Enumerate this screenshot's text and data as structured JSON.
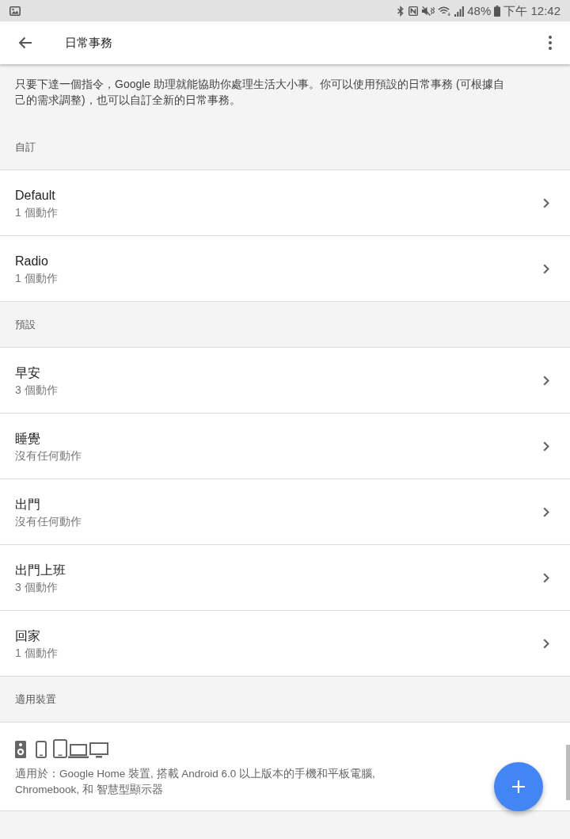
{
  "status_bar": {
    "battery": "48%",
    "time": "下午 12:42"
  },
  "app_bar": {
    "title": "日常事務"
  },
  "description": "只要下達一個指令，Google 助理就能協助你處理生活大小事。你可以使用預設的日常事務 (可根據自己的需求調整)，也可以自訂全新的日常事務。",
  "sections": [
    {
      "header": "自訂",
      "items": [
        {
          "title": "Default",
          "subtitle": "1 個動作"
        },
        {
          "title": "Radio",
          "subtitle": "1 個動作"
        }
      ]
    },
    {
      "header": "預設",
      "items": [
        {
          "title": "早安",
          "subtitle": "3 個動作"
        },
        {
          "title": "睡覺",
          "subtitle": "沒有任何動作"
        },
        {
          "title": "出門",
          "subtitle": "沒有任何動作"
        },
        {
          "title": "出門上班",
          "subtitle": "3 個動作"
        },
        {
          "title": "回家",
          "subtitle": "1 個動作"
        }
      ]
    }
  ],
  "devices": {
    "header": "適用裝置",
    "text": "適用於：Google Home 裝置, 搭載 Android 6.0 以上版本的手機和平板電腦, Chromebook, 和 智慧型顯示器"
  }
}
